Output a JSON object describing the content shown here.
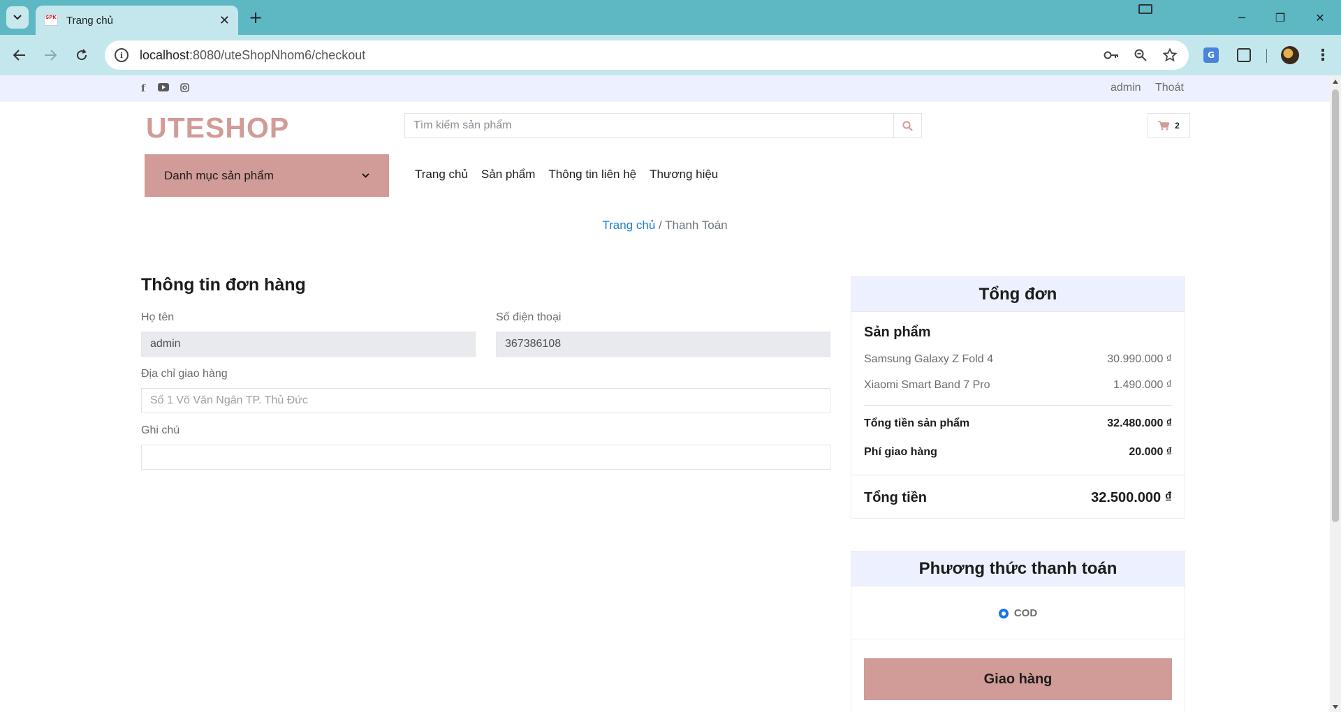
{
  "browser": {
    "tab_title": "Trang chủ",
    "url_host": "localhost",
    "url_rest": ":8080/uteShopNhom6/checkout",
    "favicon_text": "SPK"
  },
  "topbar": {
    "social_icons": [
      "facebook-icon",
      "youtube-icon",
      "instagram-icon"
    ],
    "user_label": "admin",
    "logout_label": "Thoát"
  },
  "header": {
    "logo": "UTESHOP",
    "search_placeholder": "Tìm kiếm sản phẩm",
    "cart_count": "2"
  },
  "nav": {
    "category_label": "Danh mục sản phẩm",
    "links": [
      "Trang chủ",
      "Sản phẩm",
      "Thông tin liên hệ",
      "Thương hiệu"
    ]
  },
  "breadcrumb": {
    "home": "Trang chủ",
    "separator": " / ",
    "current": "Thanh Toán"
  },
  "order_form": {
    "title": "Thông tin đơn hàng",
    "name_label": "Họ tên",
    "name_value": "admin",
    "phone_label": "Số điện thoại",
    "phone_value": "367386108",
    "address_label": "Địa chỉ giao hàng",
    "address_placeholder": "Số 1 Võ Văn Ngân TP. Thủ Đức",
    "note_label": "Ghi chú",
    "note_value": ""
  },
  "summary": {
    "title": "Tổng đơn",
    "products_heading": "Sản phẩm",
    "items": [
      {
        "name": "Samsung Galaxy Z Fold 4",
        "price": "30.990.000 ₫"
      },
      {
        "name": "Xiaomi Smart Band 7 Pro",
        "price": "1.490.000 ₫"
      }
    ],
    "subtotal_label": "Tổng tiền sản phẩm",
    "subtotal_value": "32.480.000 ₫",
    "shipping_label": "Phí giao hàng",
    "shipping_value": "20.000 ₫",
    "total_label": "Tổng tiền",
    "total_value": "32.500.000 ₫"
  },
  "payment": {
    "title": "Phương thức thanh toán",
    "method": "COD",
    "submit_label": "Giao hàng"
  },
  "colors": {
    "accent": "#d19c97",
    "light_bg": "#edf1ff",
    "link": "#1a7fd4",
    "browser_frame": "#5db8c4"
  }
}
